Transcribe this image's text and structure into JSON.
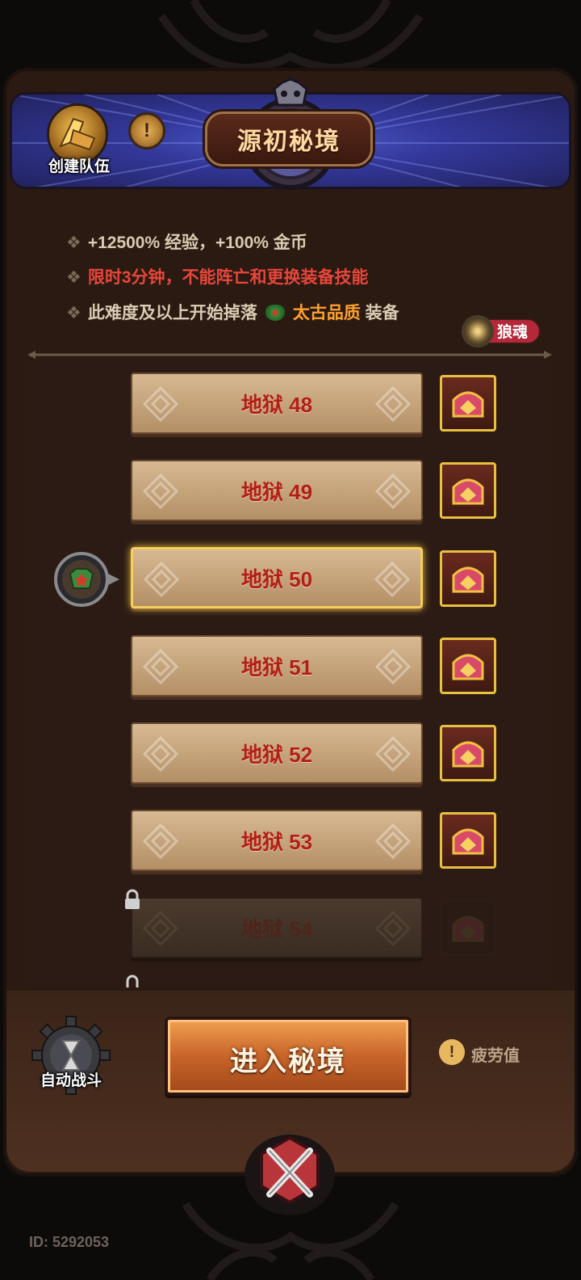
{
  "header": {
    "title": "源初秘境",
    "create_team_label": "创建队伍",
    "info_button_glyph": "!"
  },
  "info": {
    "bonus_line": "+12500% 经验，+100% 金币",
    "rule_line": "限时3分钟，不能阵亡和更换装备技能",
    "drop_prefix": "此难度及以上开始掉落",
    "drop_quality": "太古品质",
    "drop_suffix": "装备",
    "wolf_badge": "狼魂"
  },
  "levels": [
    {
      "label": "地狱 48",
      "state": "unlocked"
    },
    {
      "label": "地狱 49",
      "state": "unlocked"
    },
    {
      "label": "地狱 50",
      "state": "selected"
    },
    {
      "label": "地狱 51",
      "state": "unlocked"
    },
    {
      "label": "地狱 52",
      "state": "unlocked"
    },
    {
      "label": "地狱 53",
      "state": "unlocked"
    },
    {
      "label": "地狱 54",
      "state": "locked"
    }
  ],
  "footer": {
    "auto_battle_label": "自动战斗",
    "enter_button_label": "进入秘境",
    "fatigue_label": "疲劳值",
    "fatigue_glyph": "!",
    "id_text": "ID: 5292053"
  },
  "icons": {
    "avatar": "axe-helmet-icon",
    "chest": "treasure-chest-icon",
    "lock": "lock-icon",
    "gear": "hourglass-gear-icon",
    "emblem": "crossed-swords-icon",
    "pointer": "armor-pointer-icon",
    "wolf": "wolf-icon",
    "drop_gem": "armor-gem-icon"
  },
  "colors": {
    "accent_gold": "#e8c040",
    "red_text": "#e8463a",
    "orange_text": "#ffa22e",
    "level_text": "#b21e16"
  }
}
